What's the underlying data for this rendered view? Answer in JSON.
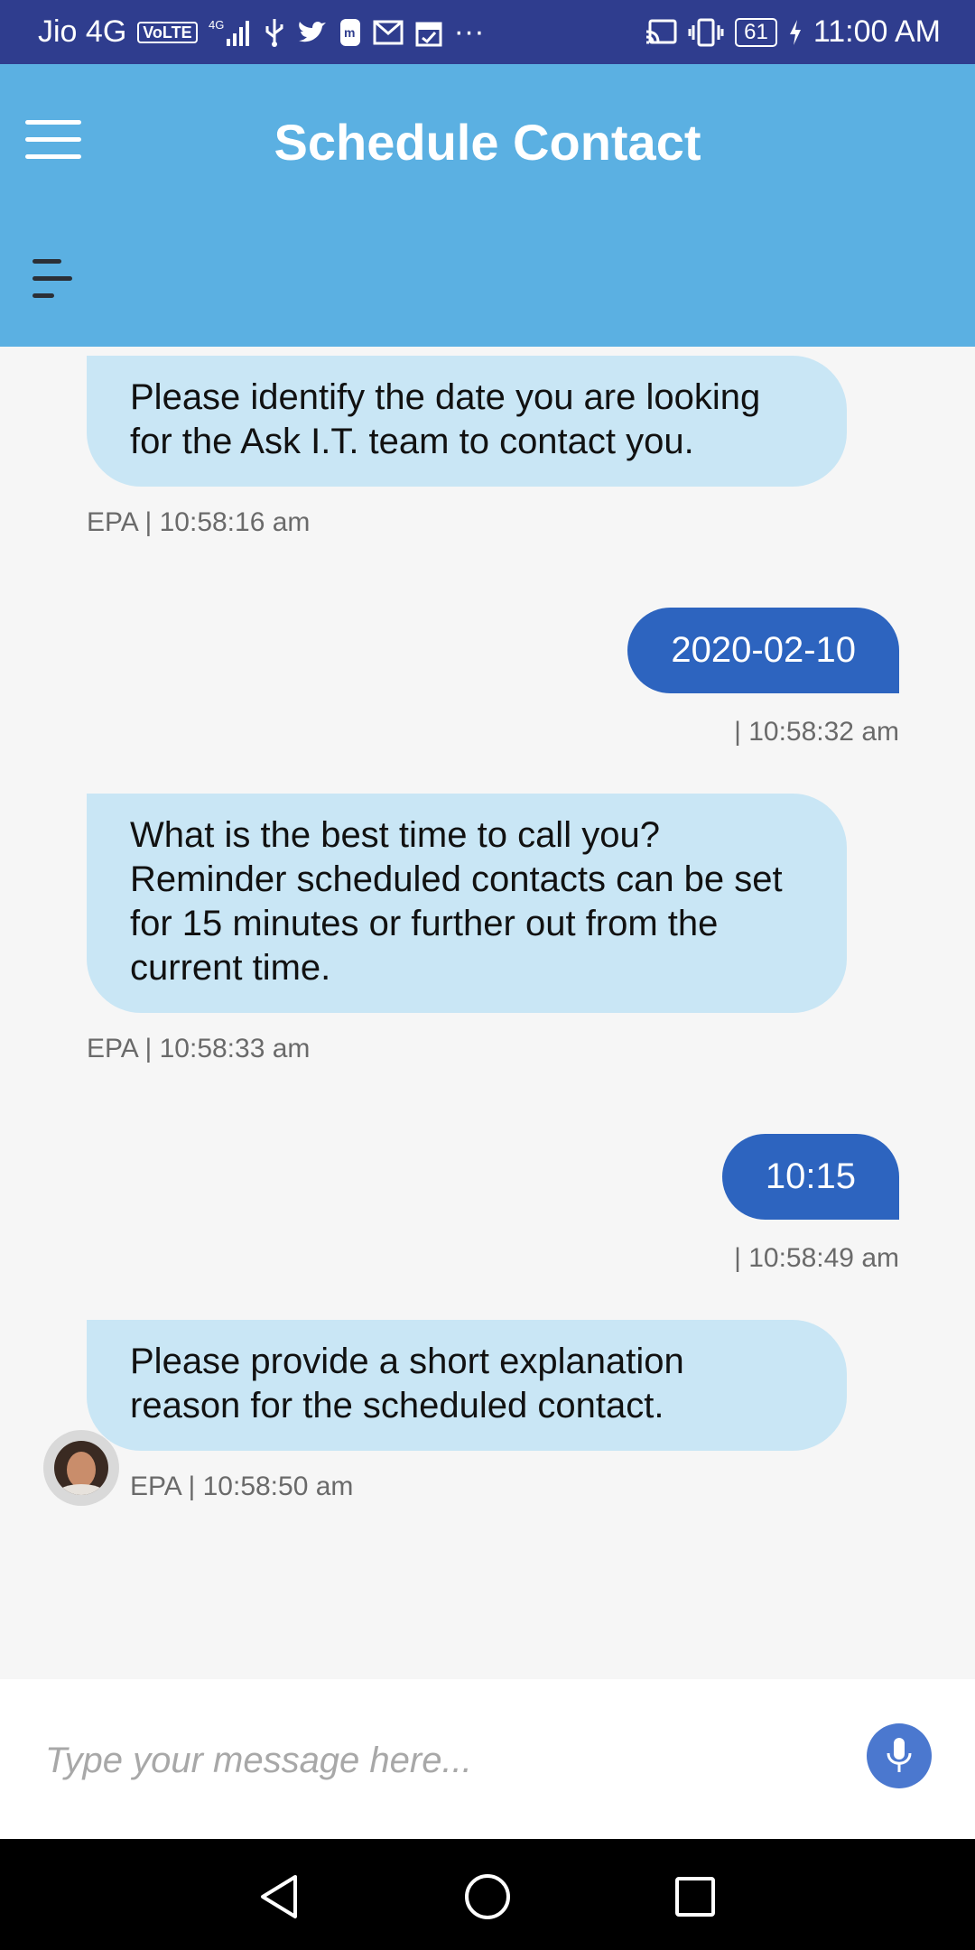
{
  "status_bar": {
    "carrier": "Jio 4G",
    "volte": "VoLTE",
    "network": "4G",
    "battery": "61",
    "time": "11:00 AM",
    "more": "···"
  },
  "header": {
    "title": "Schedule Contact"
  },
  "messages": [
    {
      "from": "bot",
      "text": "Please identify the date you are looking for the Ask I.T. team to contact you.",
      "meta": "EPA | 10:58:16 am"
    },
    {
      "from": "user",
      "text": "2020-02-10",
      "meta": "| 10:58:32 am"
    },
    {
      "from": "bot",
      "text": "What is the best time to call you? Reminder scheduled contacts can be set for 15 minutes or further out from the current time.",
      "meta": "EPA | 10:58:33 am"
    },
    {
      "from": "user",
      "text": "10:15",
      "meta": "| 10:58:49 am"
    },
    {
      "from": "bot",
      "text": "Please provide a short explanation reason for the scheduled contact.",
      "meta": "EPA | 10:58:50 am"
    }
  ],
  "composer": {
    "placeholder": "Type your message here...",
    "value": ""
  },
  "icons": {
    "menu": "hamburger-menu-icon",
    "drawer": "drawer-toggle-icon",
    "mic": "microphone-icon",
    "nav_back": "back-triangle-icon",
    "nav_home": "home-circle-icon",
    "nav_recents": "recents-square-icon"
  },
  "colors": {
    "status_bar": "#2f3d8e",
    "header": "#5bb0e2",
    "bot_bubble": "#c9e6f5",
    "user_bubble": "#2d64bf",
    "mic_button": "#4b78cf"
  }
}
